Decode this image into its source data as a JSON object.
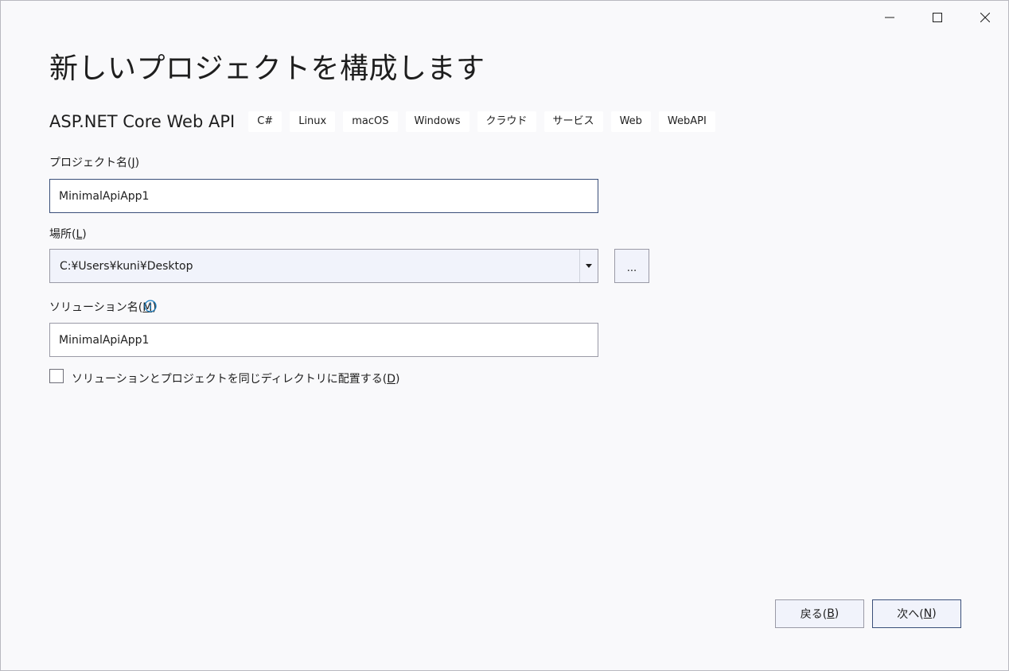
{
  "window": {
    "controls": [
      {
        "name": "minimize",
        "icon": "minimize-icon"
      },
      {
        "name": "maximize",
        "icon": "maximize-icon"
      },
      {
        "name": "close",
        "icon": "close-icon"
      }
    ]
  },
  "page_title": "新しいプロジェクトを構成します",
  "template": {
    "name": "ASP.NET Core Web API",
    "tags": [
      "C#",
      "Linux",
      "macOS",
      "Windows",
      "クラウド",
      "サービス",
      "Web",
      "WebAPI"
    ]
  },
  "project_name": {
    "label_text": "プロジェクト名(",
    "label_key": "J",
    "label_end": ")",
    "value": "MinimalApiApp1"
  },
  "location": {
    "label_text": "場所(",
    "label_key": "L",
    "label_end": ")",
    "value": "C:¥Users¥kuni¥Desktop",
    "browse_label": "..."
  },
  "solution_name": {
    "label_text": "ソリューション名(",
    "label_key": "M",
    "label_end": ")",
    "value": "MinimalApiApp1",
    "info_icon": "info-icon"
  },
  "same_directory": {
    "label_text": "ソリューションとプロジェクトを同じディレクトリに配置する(",
    "label_key": "D",
    "label_end": ")",
    "checked": false
  },
  "buttons": {
    "back": {
      "text": "戻る(",
      "key": "B",
      "end": ")"
    },
    "next": {
      "text": "次へ(",
      "key": "N",
      "end": ")"
    }
  },
  "colors": {
    "background": "#f9f9fb",
    "focus_border": "#3a4f79",
    "info_icon": "#1a7fc1"
  }
}
